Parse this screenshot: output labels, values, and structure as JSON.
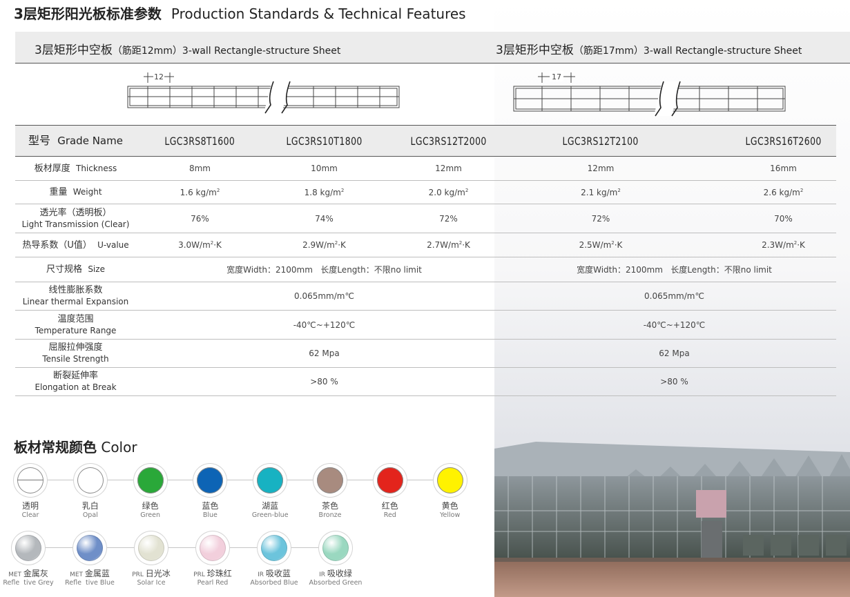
{
  "title": {
    "zh": "3层矩形阳光板标准参数",
    "en": "Production Standards & Technical Features"
  },
  "sheets": [
    {
      "zh": "3层矩形中空板",
      "spacing": "（筋距12mm）",
      "en": "3-wall Rectangle-structure Sheet",
      "dim": "12"
    },
    {
      "zh": "3层矩形中空板",
      "spacing": "（筋距17mm）",
      "en": "3-wall Rectangle-structure Sheet",
      "dim": "17"
    }
  ],
  "table": {
    "header": {
      "zh": "型号",
      "en": "Grade Name",
      "grades": [
        "LGC3RS8T1600",
        "LGC3RS10T1800",
        "LGC3RS12T2000",
        "LGC3RS12T2100",
        "LGC3RS16T2600"
      ]
    },
    "thickness": {
      "zh": "板材厚度",
      "en": "Thickness",
      "values": [
        "8mm",
        "10mm",
        "12mm",
        "12mm",
        "16mm"
      ]
    },
    "weight": {
      "zh": "重量",
      "en": "Weight",
      "values": [
        "1.6 kg/m",
        "1.8 kg/m",
        "2.0 kg/m",
        "2.1 kg/m",
        "2.6 kg/m"
      ],
      "sup": "2"
    },
    "transmission": {
      "zh": "透光率（透明板）",
      "en": "Light Transmission (Clear)",
      "values": [
        "76%",
        "74%",
        "72%",
        "72%",
        "70%"
      ]
    },
    "uvalue": {
      "zh": "热导系数（U值）",
      "en": "U-value",
      "values": [
        "3.0W/m",
        "2.9W/m",
        "2.7W/m",
        "2.5W/m",
        "2.3W/m"
      ],
      "sup": "2",
      "suffix": "·K"
    },
    "size": {
      "zh": "尺寸规格",
      "en": "Size",
      "group1": "宽度Width：2100mm   长度Length：不限no limit",
      "group2": "宽度Width：2100mm   长度Length：不限no limit"
    },
    "expansion": {
      "zh": "线性膨胀系数",
      "en": "Linear thermal Expansion",
      "group1": "0.065mm/m℃",
      "group2": "0.065mm/m℃"
    },
    "temperature": {
      "zh": "温度范围",
      "en": "Temperature Range",
      "group1": "-40℃~+120℃",
      "group2": "-40℃~+120℃"
    },
    "tensile": {
      "zh": "屈服拉伸强度",
      "en": "Tensile Strength",
      "group1": "62 Mpa",
      "group2": "62 Mpa"
    },
    "elongation": {
      "zh": "断裂延伸率",
      "en": "Elongation at Break",
      "group1": ">80 %",
      "group2": ">80 %"
    }
  },
  "colors": {
    "title_zh": "板材常规颜色",
    "title_en": "Color",
    "row1": [
      {
        "zh": "透明",
        "en": "Clear",
        "icon": "clear-swatch",
        "color": "#ffffff"
      },
      {
        "zh": "乳白",
        "en": "Opal",
        "icon": "opal-swatch",
        "color": "#ffffff"
      },
      {
        "zh": "绿色",
        "en": "Green",
        "icon": "green-swatch",
        "color": "#2aa839"
      },
      {
        "zh": "蓝色",
        "en": "Blue",
        "icon": "blue-swatch",
        "color": "#0d64b5"
      },
      {
        "zh": "湖蓝",
        "en": "Green-blue",
        "icon": "green-blue-swatch",
        "color": "#17b2c2"
      },
      {
        "zh": "茶色",
        "en": "Bronze",
        "icon": "bronze-swatch",
        "color": "#a88b7f"
      },
      {
        "zh": "红色",
        "en": "Red",
        "icon": "red-swatch",
        "color": "#e3241c"
      },
      {
        "zh": "黄色",
        "en": "Yellow",
        "icon": "yellow-swatch",
        "color": "#fff200"
      }
    ],
    "row2": [
      {
        "pre": "MET",
        "zh": "金属灰",
        "en": "Refle  tive Grey",
        "icon": "metallic-grey-swatch",
        "color": "#b4b8bc"
      },
      {
        "pre": "MET",
        "zh": "金属蓝",
        "en": "Refle  tive Blue",
        "icon": "metallic-blue-swatch",
        "color": "#6f8fc8"
      },
      {
        "pre": "PRL",
        "zh": "日光冰",
        "en": "Solar Ice",
        "icon": "solar-ice-swatch",
        "color": "#e2e2d2"
      },
      {
        "pre": "PRL",
        "zh": "珍珠红",
        "en": "Pearl Red",
        "icon": "pearl-red-swatch",
        "color": "#f2cfdc"
      },
      {
        "pre": "IR",
        "zh": "吸收蓝",
        "en": "Absorbed Blue",
        "icon": "absorbed-blue-swatch",
        "color": "#6cc4dc"
      },
      {
        "pre": "IR",
        "zh": "吸收绿",
        "en": "Absorbed Green",
        "icon": "absorbed-green-swatch",
        "color": "#9ad8c0"
      }
    ]
  }
}
